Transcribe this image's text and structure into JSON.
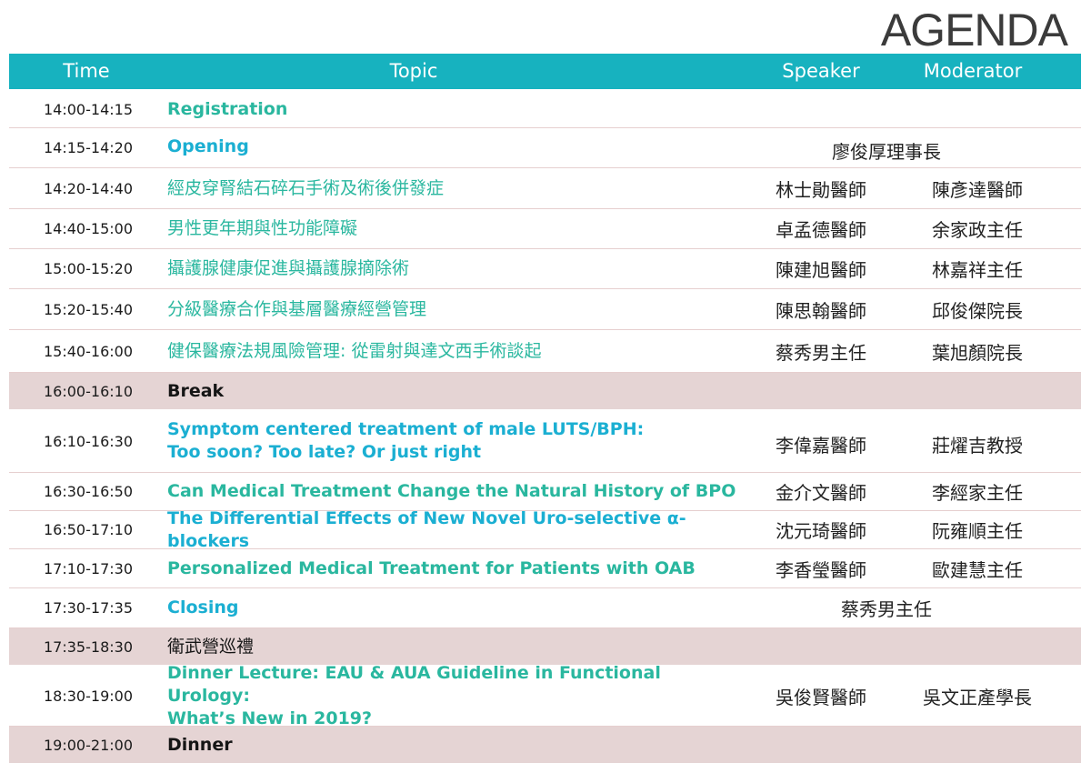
{
  "title": "AGENDA",
  "header": {
    "time": "Time",
    "topic": "Topic",
    "speaker": "Speaker",
    "moderator": "Moderator"
  },
  "colors": {
    "header_bg": "#17b2bf",
    "teal_text": "#2ab79f",
    "blue_text": "#1bafd2",
    "break_row_bg": "#e5d4d4"
  },
  "rows": [
    {
      "time": "14:00-14:15",
      "topic": "Registration",
      "speaker": "",
      "moderator": ""
    },
    {
      "time": "14:15-14:20",
      "topic": "Opening",
      "joint": "廖俊厚理事長"
    },
    {
      "time": "14:20-14:40",
      "topic": "經皮穿腎結石碎石手術及術後併發症",
      "speaker": "林士勛醫師",
      "moderator": "陳彥達醫師"
    },
    {
      "time": "14:40-15:00",
      "topic": "男性更年期與性功能障礙",
      "speaker": "卓孟德醫師",
      "moderator": "余家政主任"
    },
    {
      "time": "15:00-15:20",
      "topic": "攝護腺健康促進與攝護腺摘除術",
      "speaker": "陳建旭醫師",
      "moderator": "林嘉祥主任"
    },
    {
      "time": "15:20-15:40",
      "topic": "分級醫療合作與基層醫療經營管理",
      "speaker": "陳思翰醫師",
      "moderator": "邱俊傑院長"
    },
    {
      "time": "15:40-16:00",
      "topic": "健保醫療法規風險管理: 從雷射與達文西手術談起",
      "speaker": "蔡秀男主任",
      "moderator": "葉旭顏院長"
    },
    {
      "time": "16:00-16:10",
      "topic": "Break",
      "speaker": "",
      "moderator": ""
    },
    {
      "time": "16:10-16:30",
      "topic_lines": [
        "Symptom centered treatment of male LUTS/BPH:",
        "Too soon? Too late? Or just right"
      ],
      "speaker": "李偉嘉醫師",
      "moderator": "莊燿吉教授"
    },
    {
      "time": "16:30-16:50",
      "topic": "Can Medical Treatment Change the Natural History of BPO",
      "speaker": "金介文醫師",
      "moderator": "李經家主任"
    },
    {
      "time": "16:50-17:10",
      "topic": "The Differential Effects of New Novel Uro-selective α-blockers",
      "speaker": "沈元琦醫師",
      "moderator": "阮雍順主任"
    },
    {
      "time": "17:10-17:30",
      "topic": "Personalized Medical Treatment for Patients with OAB",
      "speaker": "李香瑩醫師",
      "moderator": "歐建慧主任"
    },
    {
      "time": "17:30-17:35",
      "topic": "Closing",
      "joint": "蔡秀男主任"
    },
    {
      "time": "17:35-18:30",
      "topic": "衛武營巡禮",
      "speaker": "",
      "moderator": ""
    },
    {
      "time": "18:30-19:00",
      "topic_lines": [
        "Dinner Lecture: EAU & AUA Guideline in Functional Urology:",
        "What’s New in 2019?"
      ],
      "speaker": "吳俊賢醫師",
      "moderator": "吳文正產學長"
    },
    {
      "time": "19:00-21:00",
      "topic": "Dinner",
      "speaker": "",
      "moderator": ""
    }
  ]
}
